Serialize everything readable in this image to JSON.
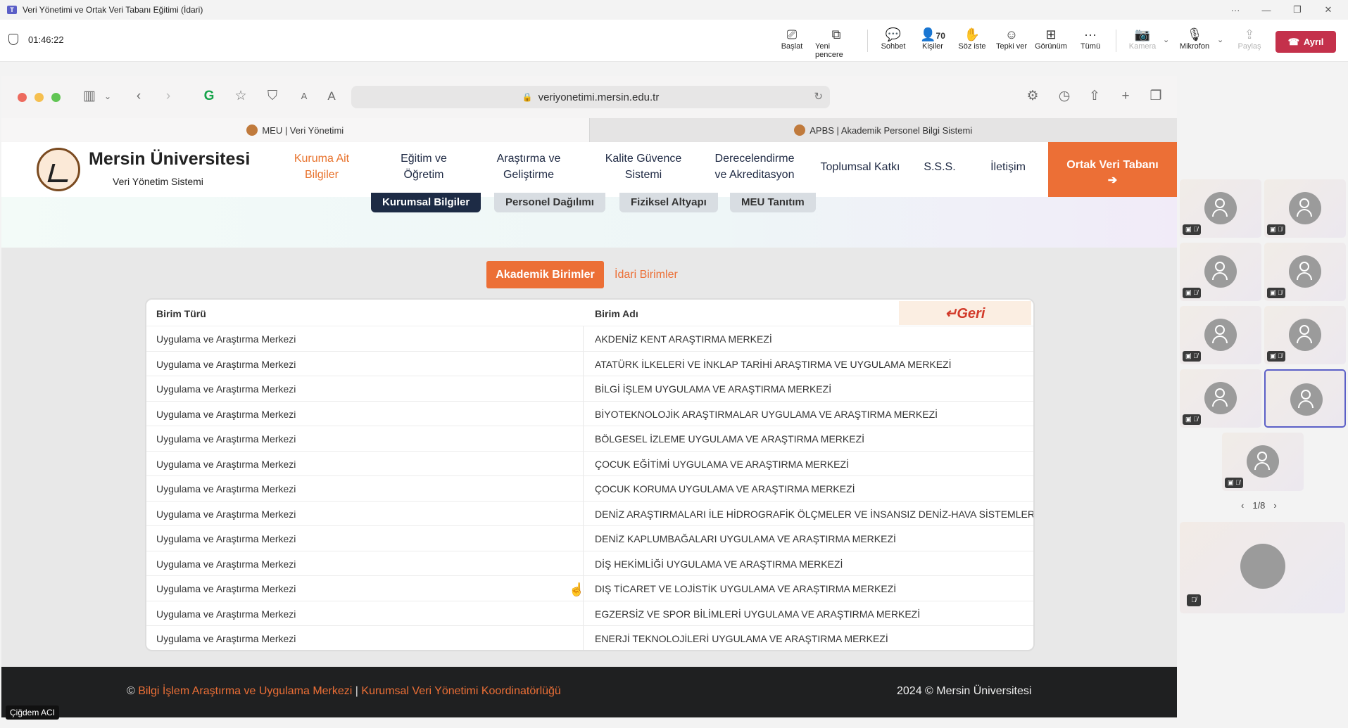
{
  "teams": {
    "window_title": "Veri Yönetimi ve Ortak Veri Tabanı Eğitimi (İdari)",
    "timer": "01:46:22",
    "toolbar": {
      "start": "Başlat",
      "new_window": "Yeni pencere",
      "chat": "Sohbet",
      "people": "Kişiler",
      "people_count": "70",
      "raise_hand": "Söz iste",
      "react": "Tepki ver",
      "view": "Görünüm",
      "more": "Tümü",
      "camera": "Kamera",
      "mic": "Mikrofon",
      "share": "Paylaş",
      "leave": "Ayrıl"
    },
    "pager": "1/8",
    "presenter_name": "Çiğdem ACI"
  },
  "browser": {
    "url": "veriyonetimi.mersin.edu.tr",
    "tabs": [
      {
        "label": "MEU | Veri Yönetimi"
      },
      {
        "label": "APBS | Akademik Personel Bilgi Sistemi"
      }
    ]
  },
  "site": {
    "name": "Mersin Üniversitesi",
    "subtitle": "Veri Yönetim Sistemi",
    "nav": [
      {
        "label": "Kuruma Ait\nBilgiler"
      },
      {
        "label": "Eğitim ve\nÖğretim"
      },
      {
        "label": "Araştırma ve\nGeliştirme"
      },
      {
        "label": "Kalite Güvence\nSistemi"
      },
      {
        "label": "Derecelendirme\nve Akreditasyon"
      },
      {
        "label": "Toplumsal Katkı"
      },
      {
        "label": "S.S.S."
      },
      {
        "label": "İletişim"
      }
    ],
    "cta": "Ortak Veri Tabanı",
    "cta_arrow": "➔",
    "hero_buttons": [
      "Kurumsal Bilgiler",
      "Personel Dağılımı",
      "Fiziksel Altyapı",
      "MEU Tanıtım"
    ],
    "unit_tabs": {
      "academic": "Akademik Birimler",
      "administrative": "İdari Birimler"
    },
    "table": {
      "headers": {
        "type": "Birim Türü",
        "name": "Birim Adı"
      },
      "back": "↵Geri",
      "rows": [
        {
          "type": "Uygulama ve Araştırma Merkezi",
          "name": "AKDENİZ KENT ARAŞTIRMA MERKEZİ"
        },
        {
          "type": "Uygulama ve Araştırma Merkezi",
          "name": "ATATÜRK İLKELERİ VE İNKLAP TARİHİ ARAŞTIRMA VE UYGULAMA MERKEZİ"
        },
        {
          "type": "Uygulama ve Araştırma Merkezi",
          "name": "BİLGİ İŞLEM UYGULAMA VE ARAŞTIRMA MERKEZİ"
        },
        {
          "type": "Uygulama ve Araştırma Merkezi",
          "name": "BİYOTEKNOLOJİK ARAŞTIRMALAR UYGULAMA VE ARAŞTIRMA MERKEZİ"
        },
        {
          "type": "Uygulama ve Araştırma Merkezi",
          "name": "BÖLGESEL İZLEME UYGULAMA VE ARAŞTIRMA MERKEZİ"
        },
        {
          "type": "Uygulama ve Araştırma Merkezi",
          "name": "ÇOCUK EĞİTİMİ UYGULAMA VE ARAŞTIRMA MERKEZİ"
        },
        {
          "type": "Uygulama ve Araştırma Merkezi",
          "name": "ÇOCUK KORUMA UYGULAMA VE ARAŞTIRMA MERKEZİ"
        },
        {
          "type": "Uygulama ve Araştırma Merkezi",
          "name": "DENİZ ARAŞTIRMALARI İLE HİDROGRAFİK ÖLÇMELER VE İNSANSIZ DENİZ-HAVA SİSTEMLERİ"
        },
        {
          "type": "Uygulama ve Araştırma Merkezi",
          "name": "DENİZ KAPLUMBAĞALARI UYGULAMA VE ARAŞTIRMA MERKEZİ"
        },
        {
          "type": "Uygulama ve Araştırma Merkezi",
          "name": "DİŞ HEKİMLİĞİ UYGULAMA VE ARAŞTIRMA MERKEZİ"
        },
        {
          "type": "Uygulama ve Araştırma Merkezi",
          "name": "DIŞ TİCARET VE LOJİSTİK UYGULAMA VE ARAŞTIRMA MERKEZİ"
        },
        {
          "type": "Uygulama ve Araştırma Merkezi",
          "name": "EGZERSİZ VE SPOR BİLİMLERİ UYGULAMA VE ARAŞTIRMA MERKEZİ"
        },
        {
          "type": "Uygulama ve Araştırma Merkezi",
          "name": "ENERJİ TEKNOLOJİLERİ UYGULAMA VE ARAŞTIRMA MERKEZİ"
        }
      ]
    },
    "footer": {
      "copyright_symbol": "©",
      "link1": "Bilgi İşlem Araştırma ve Uygulama Merkezi",
      "separator": "|",
      "link2": "Kurumsal Veri Yönetimi Koordinatörlüğü",
      "right": "2024 © Mersin Üniversitesi"
    }
  },
  "colors": {
    "accent": "#ec6f36",
    "leave": "#c4314b",
    "navy": "#1d2b45"
  }
}
